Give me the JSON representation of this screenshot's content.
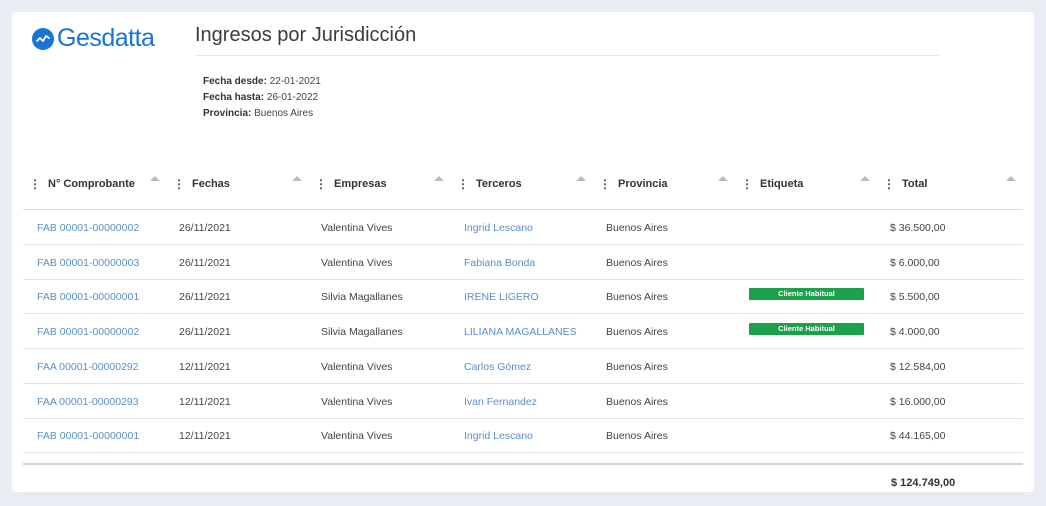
{
  "brand": {
    "name": "Gesdatta",
    "accent": "#1a73d6"
  },
  "page": {
    "title": "Ingresos por Jurisdicción"
  },
  "filters": {
    "desde_label": "Fecha desde:",
    "desde_value": "22-01-2021",
    "hasta_label": "Fecha hasta:",
    "hasta_value": "26-01-2022",
    "provincia_label": "Provincia:",
    "provincia_value": "Buenos Aires"
  },
  "table": {
    "columns": [
      "N° Comprobante",
      "Fechas",
      "Empresas",
      "Terceros",
      "Provincia",
      "Etiqueta",
      "Total"
    ],
    "rows": [
      {
        "comprobante": "FAB 00001-00000002",
        "fecha": "26/11/2021",
        "empresa": "Valentina Vives",
        "tercero": "Ingrid Lescano",
        "provincia": "Buenos Aires",
        "etiqueta": "",
        "total": "$ 36.500,00"
      },
      {
        "comprobante": "FAB 00001-00000003",
        "fecha": "26/11/2021",
        "empresa": "Valentina Vives",
        "tercero": "Fabiana Bonda",
        "provincia": "Buenos Aires",
        "etiqueta": "",
        "total": "$ 6.000,00"
      },
      {
        "comprobante": "FAB 00001-00000001",
        "fecha": "26/11/2021",
        "empresa": "Silvia Magallanes",
        "tercero": "IRENE LIGERO",
        "provincia": "Buenos Aires",
        "etiqueta": "Cliente Habitual",
        "total": "$ 5.500,00"
      },
      {
        "comprobante": "FAB 00001-00000002",
        "fecha": "26/11/2021",
        "empresa": "Silvia Magallanes",
        "tercero": "LILIANA MAGALLANES",
        "provincia": "Buenos Aires",
        "etiqueta": "Cliente Habitual",
        "total": "$ 4.000,00"
      },
      {
        "comprobante": "FAA 00001-00000292",
        "fecha": "12/11/2021",
        "empresa": "Valentina Vives",
        "tercero": "Carlos Gómez",
        "provincia": "Buenos Aires",
        "etiqueta": "",
        "total": "$ 12.584,00"
      },
      {
        "comprobante": "FAA 00001-00000293",
        "fecha": "12/11/2021",
        "empresa": "Valentina Vives",
        "tercero": "Ivan Fernandez",
        "provincia": "Buenos Aires",
        "etiqueta": "",
        "total": "$ 16.000,00"
      },
      {
        "comprobante": "FAB 00001-00000001",
        "fecha": "12/11/2021",
        "empresa": "Valentina Vives",
        "tercero": "Ingrid Lescano",
        "provincia": "Buenos Aires",
        "etiqueta": "",
        "total": "$ 44.165,00"
      }
    ],
    "grand_total": "$ 124.749,00"
  },
  "colors": {
    "link": "#5a8fc6",
    "tag": "#1ca04c"
  }
}
